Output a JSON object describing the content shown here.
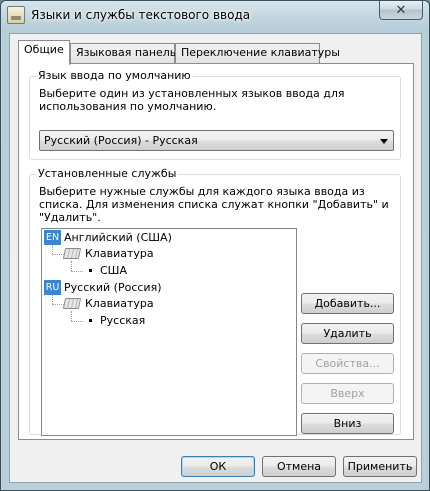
{
  "window": {
    "title": "Языки и службы текстового ввода",
    "close_glyph": "✕"
  },
  "tabs": [
    {
      "label": "Общие",
      "active": true
    },
    {
      "label": "Языковая панель",
      "active": false
    },
    {
      "label": "Переключение клавиатуры",
      "active": false
    }
  ],
  "default_language": {
    "legend": "Язык ввода по умолчанию",
    "description": "Выберите один из установленных языков ввода для использования по умолчанию.",
    "selected": "Русский (Россия) - Русская"
  },
  "installed_services": {
    "legend": "Установленные службы",
    "description": "Выберите нужные службы для каждого языка ввода из списка. Для изменения списка служат кнопки \"Добавить\" и \"Удалить\".",
    "tree": {
      "en": {
        "badge": "EN",
        "label": "Английский (США)",
        "category": "Клавиатура",
        "layout": "США"
      },
      "ru": {
        "badge": "RU",
        "label": "Русский (Россия)",
        "category": "Клавиатура",
        "layout": "Русская"
      }
    },
    "buttons": {
      "add": "Добавить...",
      "remove": "Удалить",
      "properties": "Свойства...",
      "up": "Вверх",
      "down": "Вниз"
    }
  },
  "footer": {
    "ok": "ОК",
    "cancel": "Отмена",
    "apply": "Применить"
  },
  "colors": {
    "accent": "#3a86cf",
    "window_frame": "#b6cfd9",
    "disabled_text": "#a0a0a0"
  }
}
